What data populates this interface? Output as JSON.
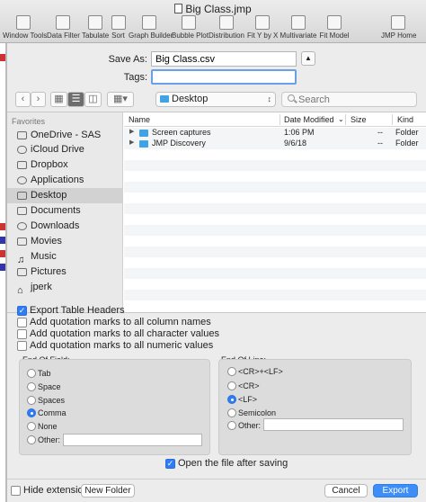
{
  "window": {
    "title": "Big Class.jmp",
    "toolbar": [
      {
        "label": "Window Tools",
        "icon": "window-tools-icon"
      },
      {
        "label": "Data Filter",
        "icon": "data-filter-icon"
      },
      {
        "label": "Tabulate",
        "icon": "tabulate-icon"
      },
      {
        "label": "Sort",
        "icon": "sort-icon"
      },
      {
        "label": "Graph Builder",
        "icon": "graph-builder-icon"
      },
      {
        "label": "Bubble Plot",
        "icon": "bubble-plot-icon"
      },
      {
        "label": "Distribution",
        "icon": "distribution-icon"
      },
      {
        "label": "Fit Y by X",
        "icon": "fit-y-by-x-icon"
      },
      {
        "label": "Multivariate",
        "icon": "multivariate-icon"
      },
      {
        "label": "Fit Model",
        "icon": "fit-model-icon"
      },
      {
        "label": "JMP Home",
        "icon": "home-icon"
      }
    ]
  },
  "save": {
    "save_as_label": "Save As:",
    "save_as_value": "Big Class.csv",
    "tags_label": "Tags:",
    "tags_value": ""
  },
  "nav": {
    "location": "Desktop",
    "search_placeholder": "Search"
  },
  "sidebar": {
    "header": "Favorites",
    "items": [
      {
        "label": "OneDrive - SAS",
        "icon": "folder-icon"
      },
      {
        "label": "iCloud Drive",
        "icon": "cloud-icon"
      },
      {
        "label": "Dropbox",
        "icon": "dropbox-icon"
      },
      {
        "label": "Applications",
        "icon": "applications-icon"
      },
      {
        "label": "Desktop",
        "icon": "desktop-icon",
        "selected": true
      },
      {
        "label": "Documents",
        "icon": "documents-icon"
      },
      {
        "label": "Downloads",
        "icon": "downloads-icon"
      },
      {
        "label": "Movies",
        "icon": "movies-icon"
      },
      {
        "label": "Music",
        "icon": "music-icon"
      },
      {
        "label": "Pictures",
        "icon": "pictures-icon"
      },
      {
        "label": "jperk",
        "icon": "home-icon"
      }
    ]
  },
  "files": {
    "columns": {
      "name": "Name",
      "date": "Date Modified",
      "size": "Size",
      "kind": "Kind"
    },
    "rows": [
      {
        "name": "Screen captures",
        "date": "1:06 PM",
        "size": "--",
        "kind": "Folder"
      },
      {
        "name": "JMP Discovery",
        "date": "9/6/18",
        "size": "--",
        "kind": "Folder"
      }
    ]
  },
  "options": {
    "checkboxes": [
      {
        "label": "Export Table Headers",
        "checked": true
      },
      {
        "label": "Add quotation marks to all column names",
        "checked": false
      },
      {
        "label": "Add quotation marks to all character values",
        "checked": false
      },
      {
        "label": "Add quotation marks to all numeric values",
        "checked": false
      }
    ],
    "end_of_field": {
      "title": "End Of Field:",
      "options": [
        "Tab",
        "Space",
        "Spaces",
        "Comma",
        "None",
        "Other:"
      ],
      "selected": "Comma"
    },
    "end_of_line": {
      "title": "End Of Line:",
      "options": [
        "<CR>+<LF>",
        "<CR>",
        "<LF>",
        "Semicolon",
        "Other:"
      ],
      "selected": "<LF>"
    },
    "open_after_saving": {
      "label": "Open the file after saving",
      "checked": true
    }
  },
  "footer": {
    "hide_extension": {
      "label": "Hide extension",
      "checked": false
    },
    "new_folder": "New Folder",
    "cancel": "Cancel",
    "export": "Export"
  }
}
